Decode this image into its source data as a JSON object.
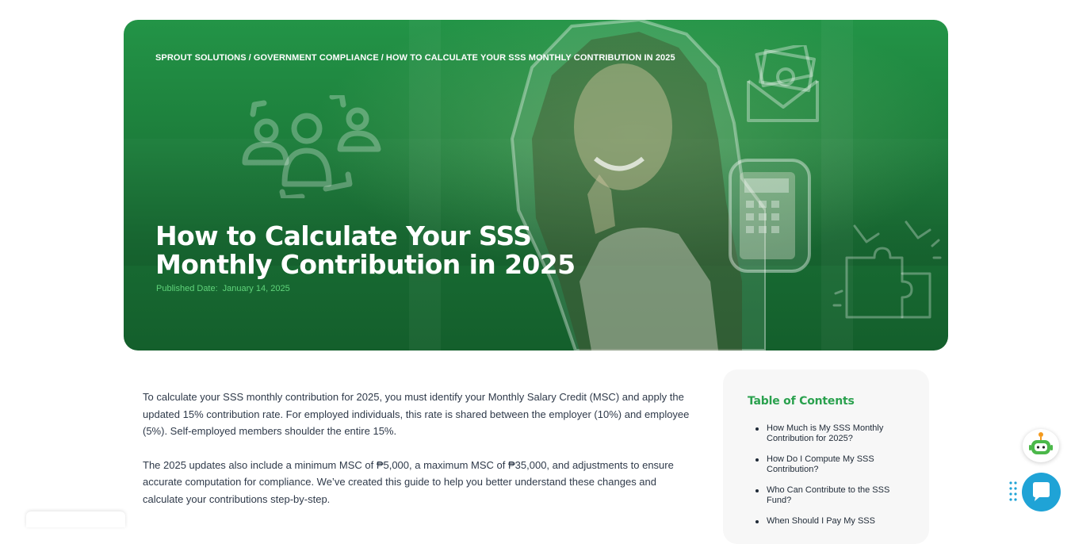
{
  "hero": {
    "breadcrumb": {
      "items": [
        "SPROUT SOLUTIONS",
        "GOVERNMENT COMPLIANCE",
        "HOW TO CALCULATE YOUR SSS MONTHLY CONTRIBUTION IN 2025"
      ],
      "separator": "/"
    },
    "title": "How to Calculate Your SSS Monthly Contribution in 2025",
    "published_label": "Published Date:",
    "published_date": "January 14, 2025",
    "colors": {
      "background": "#1d7f3c",
      "accent_text": "#5fd37a"
    },
    "icons": [
      "team-icon",
      "money-envelope-icon",
      "puzzle-handshake-icon",
      "calculator-icon"
    ]
  },
  "article": {
    "paragraphs": [
      "To calculate your SSS monthly contribution for 2025, you must identify your Monthly Salary Credit (MSC) and apply the updated 15% contribution rate. For employed individuals, this rate is shared between the employer (10%) and employee (5%). Self-employed members shoulder the entire 15%.",
      "The 2025 updates also include a minimum MSC of ₱5,000, a maximum MSC of ₱35,000, and adjustments to ensure accurate computation for compliance. We’ve created this guide to help you better understand these changes and calculate your contributions step-by-step."
    ]
  },
  "toc": {
    "title": "Table of Contents",
    "items": [
      "How Much is My SSS Monthly Contribution for 2025?",
      "How Do I Compute My SSS Contribution?",
      "Who Can Contribute to the SSS Fund?",
      "When Should I Pay My SSS"
    ],
    "colors": {
      "title": "#2aa14e",
      "panel": "#f7f7f7"
    }
  },
  "widgets": {
    "chat_color": "#1fa3d6",
    "icons": [
      "bot-assistant-icon",
      "chat-bubble-icon",
      "drag-handle-icon"
    ]
  }
}
